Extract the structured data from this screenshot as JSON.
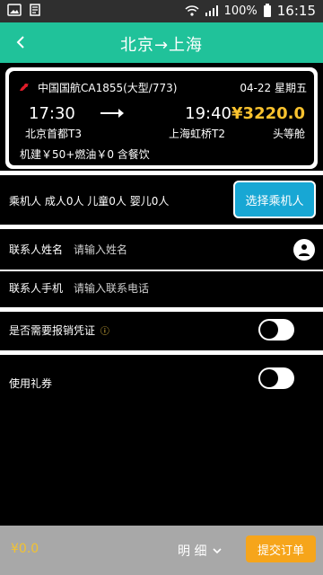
{
  "status_bar": {
    "battery": "100%",
    "time": "16:15"
  },
  "header": {
    "title": "北京→上海"
  },
  "flight": {
    "airline_flight": "中国国航CA1855(大型/773)",
    "date_cabin": "04-22 星期五",
    "dep_time": "17:30",
    "arr_time": "19:40",
    "price": "¥3220.0",
    "dep_airport": "北京首都T3",
    "arr_airport": "上海虹桥T2",
    "cabin": "头等舱",
    "services": "机建￥50+燃油￥0  含餐饮"
  },
  "passengers": {
    "summary": "乘机人 成人0人 儿童0人 婴儿0人",
    "button_label": "选择乘机人"
  },
  "contact": {
    "name_label": "联系人姓名",
    "name_placeholder": "请输入姓名",
    "phone_label": "联系人手机",
    "phone_placeholder": "请输入联系电话"
  },
  "options": {
    "invoice_label": "是否需要报销凭证",
    "coupon_label": "使用礼券"
  },
  "footer": {
    "total": "¥0.0",
    "detail_label": "明 细",
    "submit_label": "提交订单"
  },
  "colors": {
    "primary": "#20c29a",
    "accent_blue": "#18a7d4",
    "accent_orange": "#f6a51b",
    "price_gold": "#f9c22e"
  }
}
